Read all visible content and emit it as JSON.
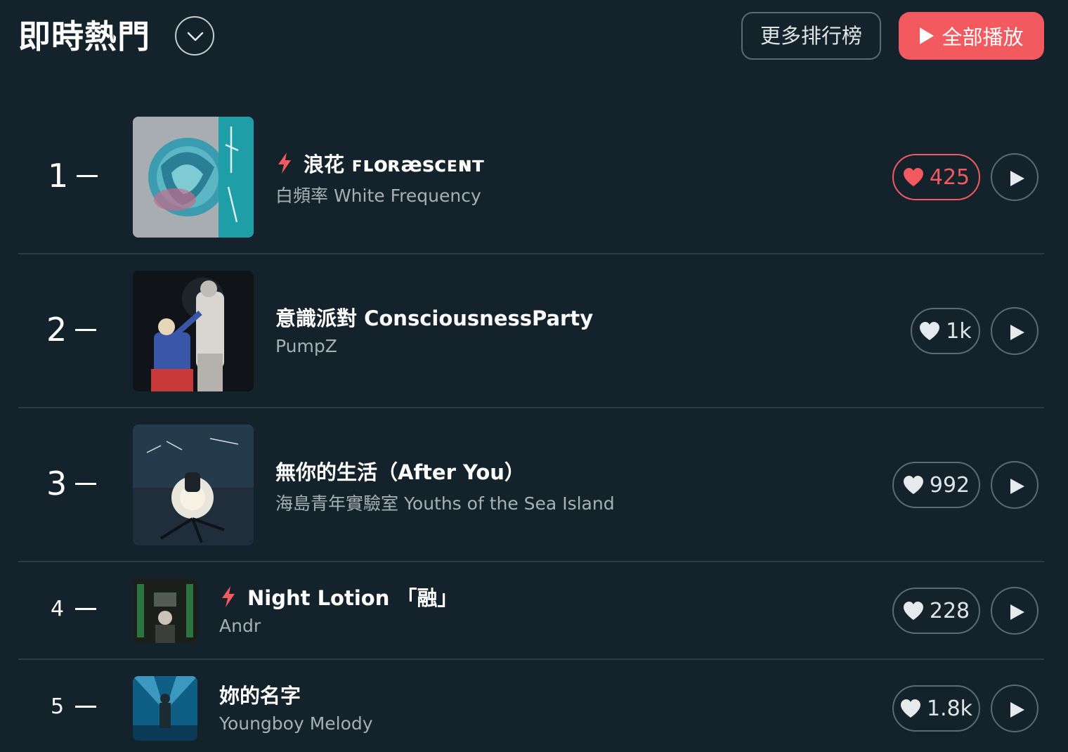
{
  "header": {
    "title": "即時熱門",
    "more_charts_label": "更多排行榜",
    "play_all_label": "全部播放"
  },
  "colors": {
    "background": "#14222b",
    "accent": "#f25a5f",
    "muted_text": "#a6b0b6",
    "border": "#5c6a72"
  },
  "songs": [
    {
      "rank": "1",
      "title": "浪花 ꜰʟᴏʀæꜱᴄᴇɴᴛ",
      "artist": "白頻率 White Frequency",
      "likes": "425",
      "liked": true,
      "hot": true,
      "cover_icon": "rose-album-cover"
    },
    {
      "rank": "2",
      "title": "意識派對 ConsciousnessParty",
      "artist": "PumpZ",
      "likes": "1k",
      "liked": false,
      "hot": false,
      "cover_icon": "concert-album-cover"
    },
    {
      "rank": "3",
      "title": "無你的生活（After You）",
      "artist": "海島青年實驗室 Youths of the Sea Island",
      "likes": "992",
      "liked": false,
      "hot": false,
      "cover_icon": "night-sea-album-cover"
    },
    {
      "rank": "4",
      "title": "Night Lotion 「融」",
      "artist": "Andr",
      "likes": "228",
      "liked": false,
      "hot": true,
      "cover_icon": "night-lotion-album-cover"
    },
    {
      "rank": "5",
      "title": "妳的名字",
      "artist": "Youngboy Melody",
      "likes": "1.8k",
      "liked": false,
      "hot": false,
      "cover_icon": "stage-album-cover"
    }
  ]
}
